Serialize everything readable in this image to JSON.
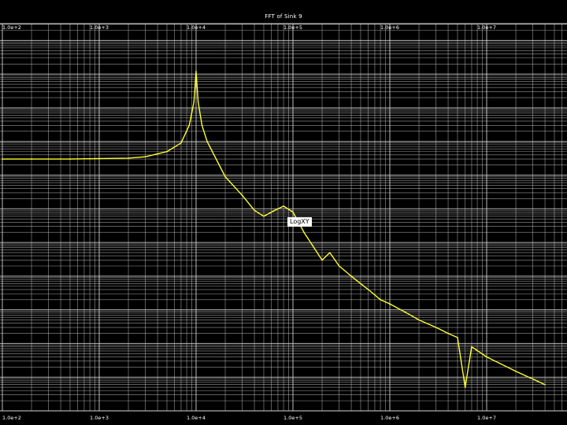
{
  "window": {
    "title": "FFT of Sink 9",
    "mode_badge": "LogXY"
  },
  "colors": {
    "background": "#000000",
    "grid": "#d8d8d8",
    "trace": "#ffff33",
    "text": "#ffffff"
  },
  "chart_data": {
    "type": "line",
    "title": "FFT of Sink 9",
    "xlabel": "",
    "ylabel": "",
    "xscale": "log",
    "yscale": "log",
    "xlim": [
      100,
      50000000
    ],
    "grid": true,
    "x_tick_labels_top": [
      "1.0e+2",
      "1.0e+3",
      "1.0e+4",
      "1.0e+5",
      "1.0e+6",
      "1.0e+7"
    ],
    "x_tick_labels_bottom": [
      "1.0e+2",
      "1.0e+3",
      "1.0e+4",
      "1.0e+5",
      "1.0e+6",
      "1.0e+7"
    ],
    "y_tick_labels": [],
    "series": [
      {
        "x": [
          100,
          200,
          500,
          1000,
          2000,
          3000,
          5000,
          7000,
          8500,
          9500,
          10000,
          10500,
          11500,
          13000,
          20000,
          30000,
          40000,
          50000,
          65000,
          80000,
          100000,
          130000,
          160000,
          200000,
          240000,
          300000,
          400000,
          500000,
          600000,
          800000,
          1000000,
          1500000,
          2000000,
          3000000,
          4000000,
          5000000,
          6000000,
          7000000,
          10000000,
          20000000,
          40000000
        ],
        "y": [
          0.03,
          0.03,
          0.03,
          0.031,
          0.032,
          0.035,
          0.05,
          0.09,
          0.3,
          1.5,
          12,
          1.5,
          0.3,
          0.1,
          0.009,
          0.0025,
          0.0009,
          0.0006,
          0.0009,
          0.0012,
          0.0008,
          0.0002,
          8e-05,
          3e-05,
          5e-05,
          2e-05,
          1e-05,
          6e-06,
          4e-06,
          2e-06,
          1.5e-06,
          8e-07,
          5e-07,
          3e-07,
          2e-07,
          1.5e-07,
          5e-09,
          8e-08,
          4e-08,
          1.5e-08,
          6e-09
        ]
      }
    ]
  }
}
